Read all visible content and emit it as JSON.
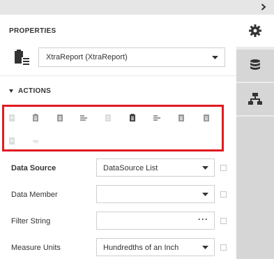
{
  "panel": {
    "title": "PROPERTIES"
  },
  "report": {
    "selected": "XtraReport (XtraReport)"
  },
  "actions": {
    "header": "ACTIONS",
    "highlight_color": "#e01a22",
    "icons": [
      "clipboard-faded-icon",
      "clipboard-icon",
      "clipboard-icon",
      "align-icon",
      "page-faded-icon",
      "clipboard-dark-icon",
      "align-icon",
      "clipboard-icon",
      "clipboard-icon",
      "clipboard-faded-icon",
      "minus-faded-icon"
    ]
  },
  "properties": [
    {
      "label": "Data Source",
      "bold": true,
      "value": "DataSource List",
      "control": "dropdown"
    },
    {
      "label": "Data Member",
      "bold": false,
      "value": "",
      "control": "dropdown"
    },
    {
      "label": "Filter String",
      "bold": false,
      "value": "",
      "control": "ellipsis",
      "ellipsis": "···"
    },
    {
      "label": "Measure Units",
      "bold": false,
      "value": "Hundredths of an Inch",
      "control": "dropdown"
    }
  ],
  "rail": {
    "tabs": [
      "gear-icon",
      "database-icon",
      "hierarchy-icon"
    ]
  }
}
